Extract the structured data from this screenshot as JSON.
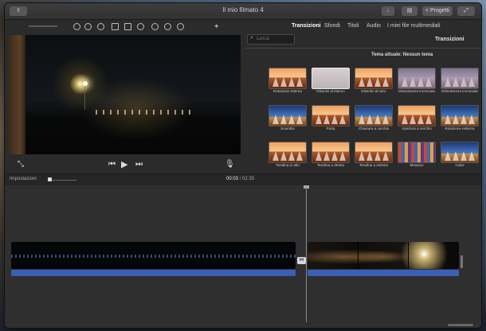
{
  "window": {
    "title": "Il mio filmato 4"
  },
  "titlebar": {
    "projects_label": "< Progetti"
  },
  "browser": {
    "tabs": [
      {
        "label": "I miei file multimediali",
        "active": false
      },
      {
        "label": "Audio",
        "active": false
      },
      {
        "label": "Titoli",
        "active": false
      },
      {
        "label": "Sfondi",
        "active": false
      },
      {
        "label": "Transizioni",
        "active": true
      }
    ],
    "search_placeholder": "Cerca",
    "panel_title": "Transizioni",
    "theme_line": "Tema attuale: Nessun tema",
    "transitions": [
      {
        "label": "Dissolvenza incrociata",
        "style": "soft"
      },
      {
        "label": "Dissolvenza incrociata",
        "style": "soft"
      },
      {
        "label": "Dissolvi al nero",
        "style": "warm"
      },
      {
        "label": "Dissolvi al bianco",
        "style": "sel"
      },
      {
        "label": "Rotazione interna",
        "style": "warm"
      },
      {
        "label": "Rotazione esterna",
        "style": "blue"
      },
      {
        "label": "Apertura a cerchio",
        "style": "warm"
      },
      {
        "label": "Chiusura a cerchio",
        "style": "blue"
      },
      {
        "label": "Porta",
        "style": "warm"
      },
      {
        "label": "Scambio",
        "style": "blue"
      },
      {
        "label": "Cubo",
        "style": "blue"
      },
      {
        "label": "Mosaico",
        "style": "mosaic"
      },
      {
        "label": "Tendina a sinistra",
        "style": "warm"
      },
      {
        "label": "Tendina a destra",
        "style": "warm"
      },
      {
        "label": "Tendina in alto",
        "style": "warm"
      }
    ]
  },
  "timeline": {
    "settings_label": "Impostazioni",
    "current_time": "00:03",
    "total_time": "/ 02:35"
  }
}
